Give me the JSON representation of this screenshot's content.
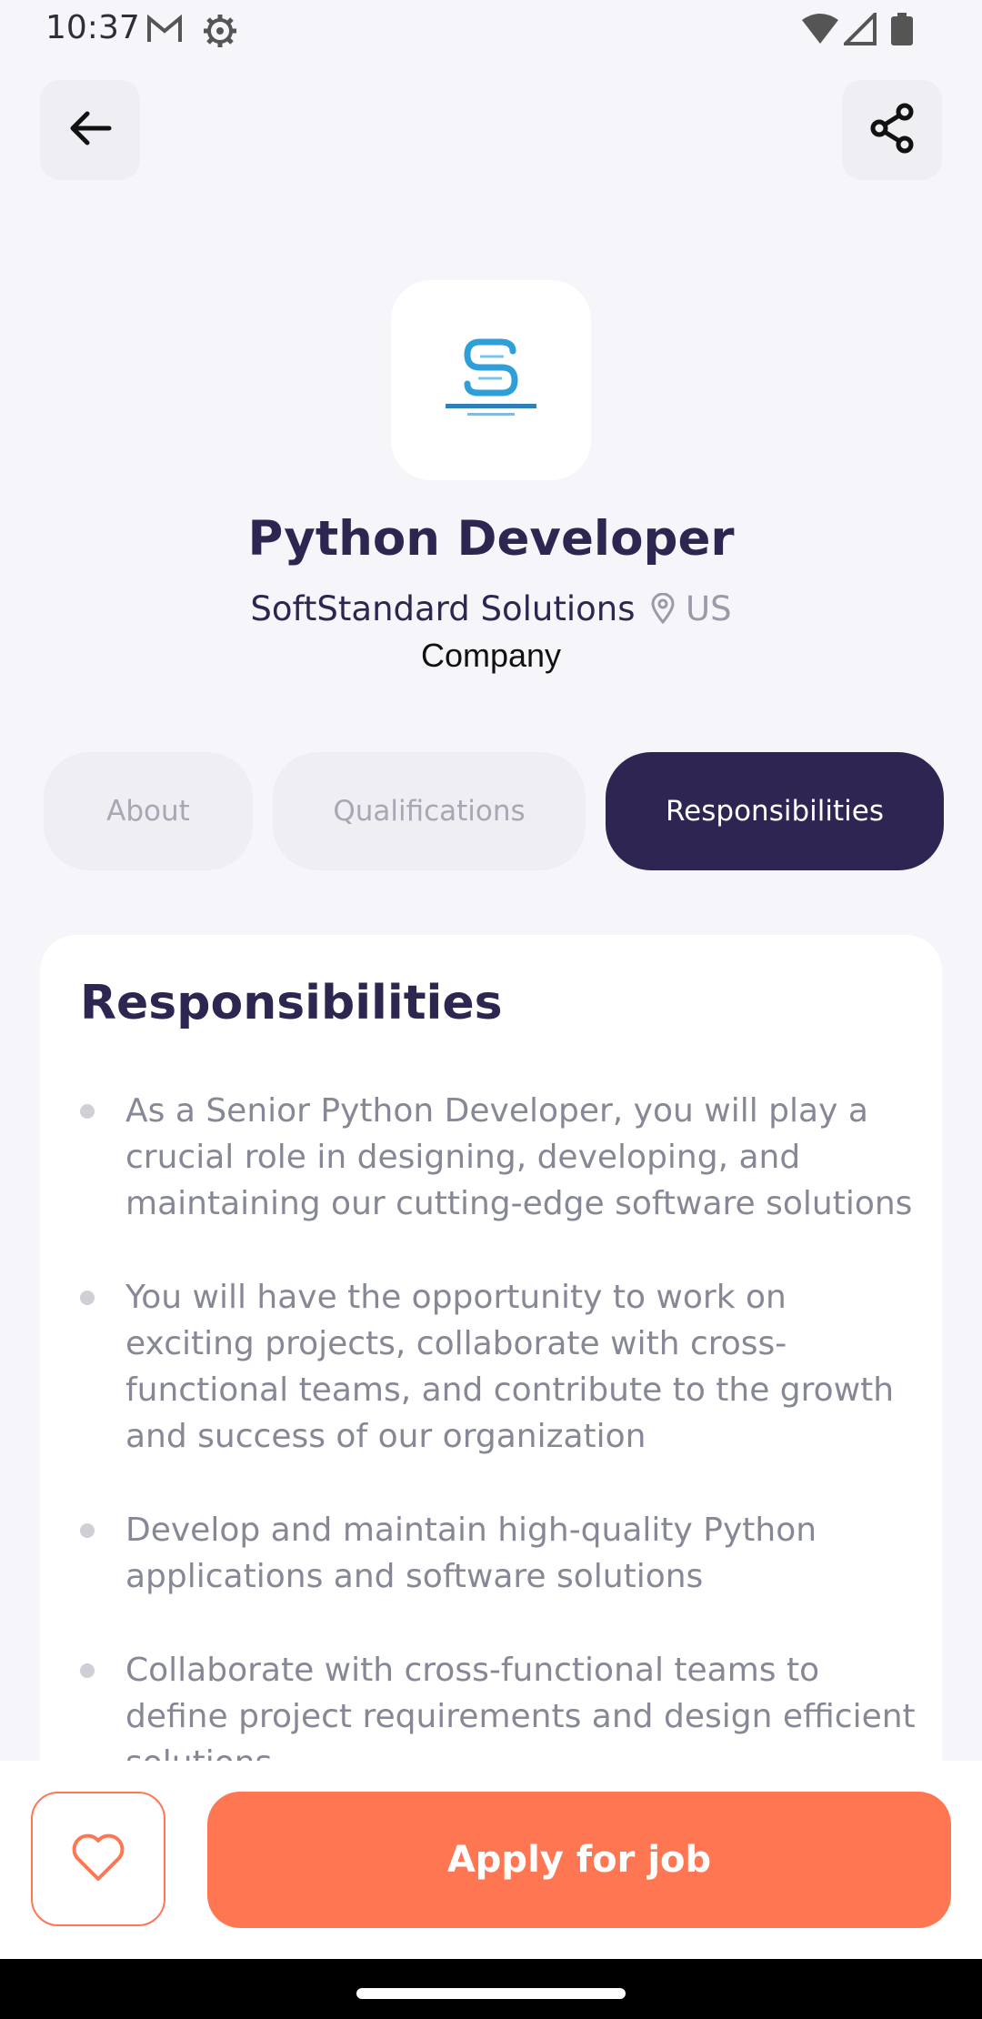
{
  "status_bar": {
    "time": "10:37",
    "icons_left": [
      "gmail-icon",
      "settings-gear-icon"
    ],
    "icons_right": [
      "wifi-icon",
      "signal-icon",
      "battery-icon"
    ]
  },
  "header": {
    "back_icon": "arrow-left-icon",
    "share_icon": "share-icon"
  },
  "job": {
    "logo_icon": "company-logo-icon",
    "title": "Python Developer",
    "company": "SoftStandard Solutions",
    "location": "US",
    "company_type": "Company"
  },
  "tabs": [
    {
      "label": "About",
      "active": false
    },
    {
      "label": "Qualifications",
      "active": false
    },
    {
      "label": "Responsibilities",
      "active": true
    }
  ],
  "section": {
    "heading": "Responsibilities",
    "items": [
      "As a Senior Python Developer, you will play a crucial role in designing, developing, and maintaining our cutting-edge software solutions",
      "You will have the opportunity to work on exciting projects, collaborate with cross-functional teams, and contribute to the growth and success of our organization",
      "Develop and maintain high-quality Python applications and software solutions",
      "Collaborate with cross-functional teams to define project requirements and design efficient solutions"
    ]
  },
  "actions": {
    "favorite_icon": "heart-icon",
    "apply_label": "Apply for job"
  },
  "colors": {
    "primary_dark": "#2e2552",
    "accent": "#ff7752",
    "background": "#f6f6fa"
  }
}
